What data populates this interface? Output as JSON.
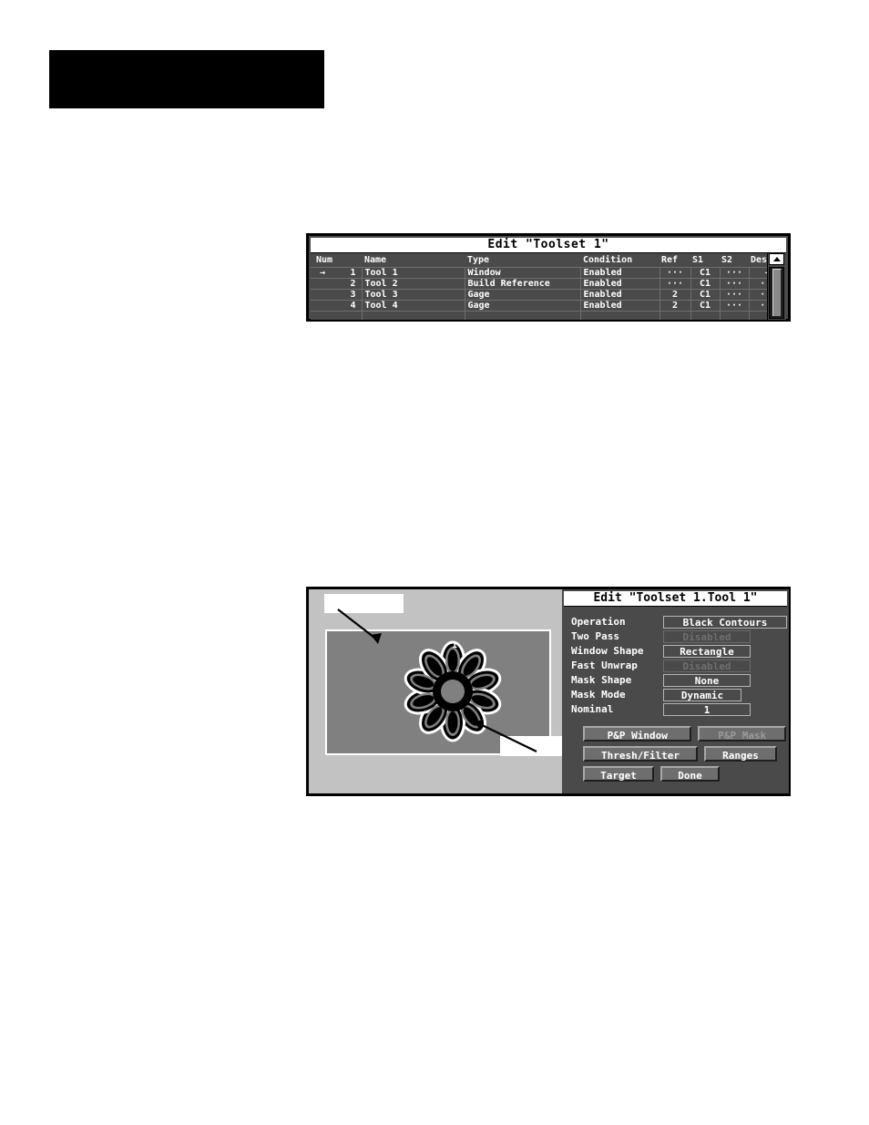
{
  "header_block": {
    "visible": true
  },
  "toolset_window": {
    "title": "Edit \"Toolset 1\"",
    "columns": [
      "Num",
      "Name",
      "Type",
      "Condition",
      "Ref",
      "S1",
      "S2",
      "Dest"
    ],
    "row_marker": "→",
    "rows": [
      {
        "marker": "→",
        "num": "1",
        "name": "Tool 1",
        "type": "Window",
        "condition": "Enabled",
        "ref": "···",
        "s1": "C1",
        "s2": "···",
        "dest": "—"
      },
      {
        "marker": "",
        "num": "2",
        "name": "Tool 2",
        "type": "Build Reference",
        "condition": "Enabled",
        "ref": "···",
        "s1": "C1",
        "s2": "···",
        "dest": "···"
      },
      {
        "marker": "",
        "num": "3",
        "name": "Tool 3",
        "type": "Gage",
        "condition": "Enabled",
        "ref": "2",
        "s1": "C1",
        "s2": "···",
        "dest": "···"
      },
      {
        "marker": "",
        "num": "4",
        "name": "Tool 4",
        "type": "Gage",
        "condition": "Enabled",
        "ref": "2",
        "s1": "C1",
        "s2": "···",
        "dest": "···"
      },
      {
        "marker": "",
        "num": "",
        "name": "",
        "type": "",
        "condition": "",
        "ref": "",
        "s1": "",
        "s2": "",
        "dest": ""
      }
    ],
    "scrollbar": {
      "up_arrow": "scroll-up-arrow"
    }
  },
  "tool_window": {
    "title": "Edit \"Toolset 1.Tool 1\"",
    "image_pane": {
      "flower_label": "1",
      "callout_top_text": "",
      "callout_bottom_text": ""
    },
    "fields": [
      {
        "label": "Operation",
        "value": "Black Contours",
        "disabled": false,
        "width": "w-long"
      },
      {
        "label": "Two Pass",
        "value": "Disabled",
        "disabled": true,
        "width": "w-mid"
      },
      {
        "label": "Window Shape",
        "value": "Rectangle",
        "disabled": false,
        "width": "w-mid"
      },
      {
        "label": "Fast Unwrap",
        "value": "Disabled",
        "disabled": true,
        "width": "w-mid"
      },
      {
        "label": "Mask Shape",
        "value": "None",
        "disabled": false,
        "width": "w-mid"
      },
      {
        "label": "Mask Mode",
        "value": "Dynamic",
        "disabled": false,
        "width": "w-short"
      },
      {
        "label": "Nominal",
        "value": "1",
        "disabled": false,
        "width": "w-mid"
      }
    ],
    "buttons": [
      {
        "label": "P&P Window",
        "disabled": false,
        "width": "bw-1"
      },
      {
        "label": "P&P Mask",
        "disabled": true,
        "width": "bw-2"
      },
      {
        "label": "Thresh/Filter",
        "disabled": false,
        "width": "bw-3"
      },
      {
        "label": "Ranges",
        "disabled": false,
        "width": "bw-4"
      },
      {
        "label": "Target",
        "disabled": false,
        "width": "bw-5"
      },
      {
        "label": "Done",
        "disabled": false,
        "width": "bw-6"
      }
    ]
  },
  "colors": {
    "panel_background": "#4a4a4a",
    "window_border": "#000000",
    "titlebar_background": "#ffffff",
    "image_background": "#808080",
    "image_pane_background": "#c2c2c2",
    "button_face": "#6e6e6e",
    "text_light": "#ffffff",
    "text_disabled": "#6f6f6f",
    "callout_fill": "#ffffff"
  }
}
